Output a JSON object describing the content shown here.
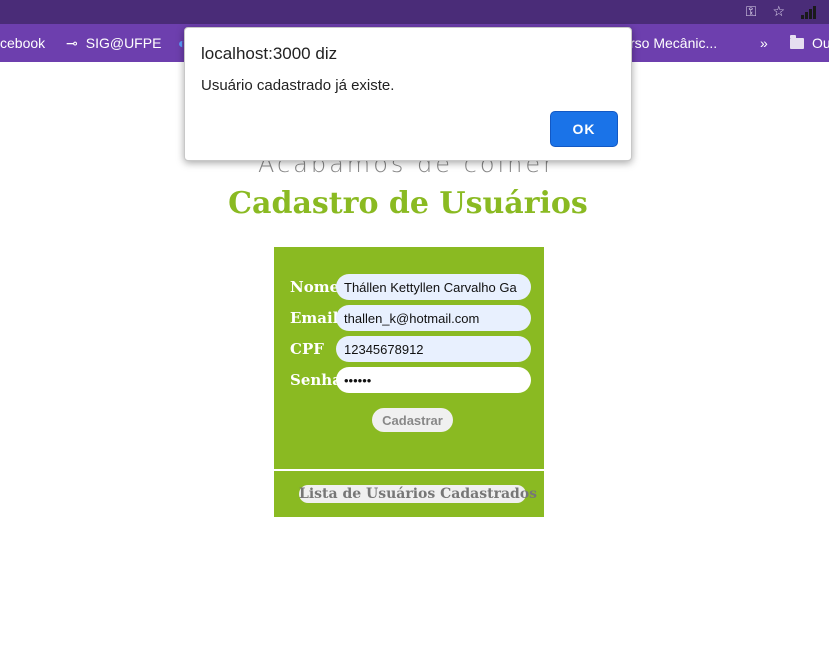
{
  "bookmarks": {
    "item1": "cebook",
    "item2": "SIG@UFPE",
    "item3": "rso Mecânic...",
    "overflow": "»",
    "item4": "Ou"
  },
  "page": {
    "tagline": "Acabamos de colher",
    "title": "Cadastro de Usuários",
    "accent_color": "#8aba22"
  },
  "form": {
    "fields": [
      {
        "label": "Nome",
        "value": "Thállen Kettyllen Carvalho Ga"
      },
      {
        "label": "Email",
        "value": "thallen_k@hotmail.com"
      },
      {
        "label": "CPF",
        "value": "12345678912"
      },
      {
        "label": "Senha",
        "value": "••••••"
      }
    ],
    "submit_label": "Cadastrar",
    "list_link_label": "Lista de Usuários Cadastrados"
  },
  "dialog": {
    "title": "localhost:3000 diz",
    "message": "Usuário cadastrado já existe.",
    "ok_label": "OK"
  },
  "icons": {
    "key": "key-icon",
    "star": "star-icon",
    "signal": "signal-icon",
    "folder": "folder-icon",
    "sig": "link-icon"
  }
}
